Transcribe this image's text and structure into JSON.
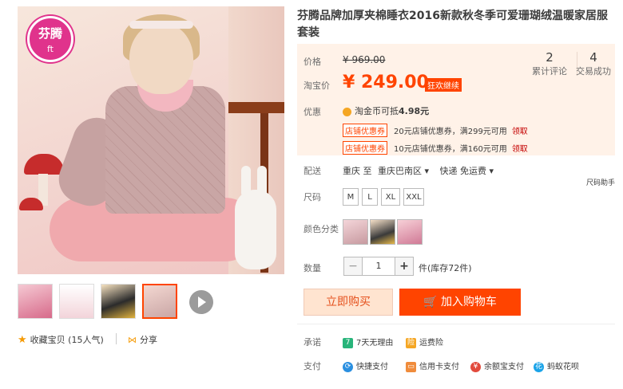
{
  "product": {
    "title": "芬腾品牌加厚夹棉睡衣2016新款秋冬季可爱珊瑚绒温暖家居服套装",
    "logo": {
      "name": "芬腾",
      "sub": "ft"
    }
  },
  "gallery": {
    "thumbs": [
      "thumb-1",
      "thumb-2",
      "thumb-3",
      "thumb-4"
    ],
    "active_index": 3
  },
  "actions": {
    "favorite": "收藏宝贝",
    "favorite_count": "(15人气)",
    "share": "分享"
  },
  "price": {
    "price_label": "价格",
    "original": "¥ 969.00",
    "promo_label": "淘宝价",
    "current": "¥ 249.00",
    "badge": "狂欢继续",
    "reviews_count": "2",
    "reviews_label": "累计评论",
    "sales_count": "4",
    "sales_label": "交易成功"
  },
  "promo": {
    "label": "优惠",
    "coin_text": "淘金币可抵",
    "coin_value": "4.98元",
    "coupons": [
      {
        "tag": "店铺优惠券",
        "text": "20元店铺优惠券，满299元可用",
        "link": "领取"
      },
      {
        "tag": "店铺优惠券",
        "text": "10元店铺优惠券，满160元可用",
        "link": "领取"
      }
    ]
  },
  "delivery": {
    "label": "配送",
    "from": "重庆 至",
    "to": "重庆巴南区",
    "shipping": "快递 免运费",
    "helper": "尺码助手"
  },
  "size": {
    "label": "尺码",
    "options": [
      "M",
      "L",
      "XL",
      "XXL"
    ]
  },
  "color": {
    "label": "颜色分类"
  },
  "quantity": {
    "label": "数量",
    "minus": "−",
    "value": "1",
    "plus": "+",
    "stock": "件(库存72件)"
  },
  "buttons": {
    "buy_now": "立即购买",
    "add_cart": "加入购物车"
  },
  "promise": {
    "label": "承诺",
    "items": [
      "7天无理由",
      "运费险"
    ]
  },
  "payment": {
    "label": "支付",
    "items": [
      "快捷支付",
      "信用卡支付",
      "余额宝支付",
      "蚂蚁花呗"
    ]
  },
  "colors": {
    "accent": "#ff4400",
    "price_bg": "#fff2e8"
  }
}
